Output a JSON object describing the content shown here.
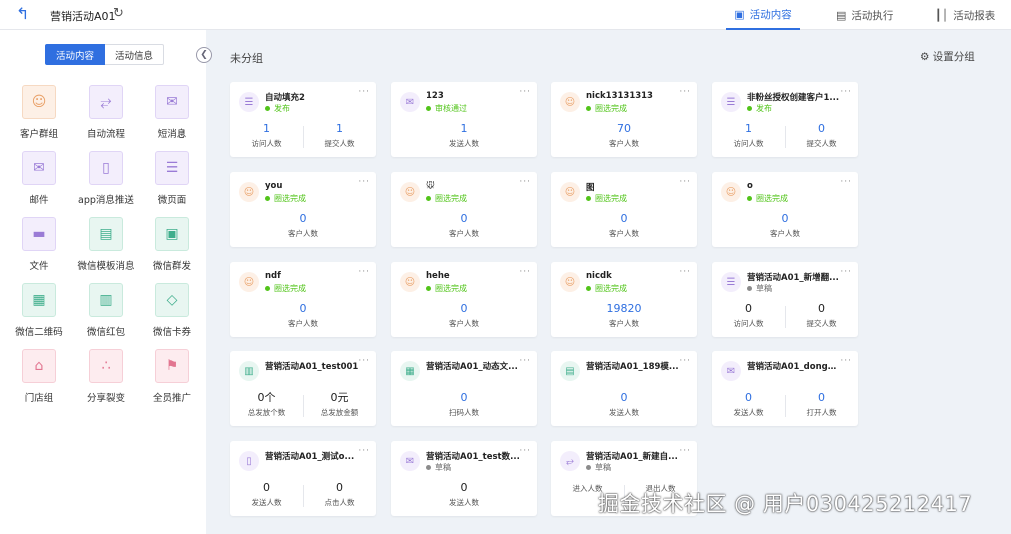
{
  "header": {
    "title": "营销活动A01",
    "tabs": [
      {
        "label": "活动内容",
        "icon": "content-icon",
        "active": true
      },
      {
        "label": "活动执行",
        "icon": "execute-icon",
        "active": false
      },
      {
        "label": "活动报表",
        "icon": "report-icon",
        "active": false
      }
    ]
  },
  "sidebar": {
    "segment": {
      "active": "活动内容",
      "other": "活动信息"
    },
    "tools": [
      {
        "label": "客户群组",
        "icon": "user-icon",
        "color": "#e9a067"
      },
      {
        "label": "自动流程",
        "icon": "flow-icon",
        "color": "#9a7bd6"
      },
      {
        "label": "短消息",
        "icon": "sms-icon",
        "color": "#9a7bd6"
      },
      {
        "label": "邮件",
        "icon": "mail-icon",
        "color": "#9a7bd6"
      },
      {
        "label": "app消息推送",
        "icon": "push-icon",
        "color": "#9a7bd6"
      },
      {
        "label": "微页面",
        "icon": "page-icon",
        "color": "#9a7bd6"
      },
      {
        "label": "文件",
        "icon": "file-icon",
        "color": "#9a7bd6"
      },
      {
        "label": "微信模板消息",
        "icon": "wechat-template-icon",
        "color": "#3fae8c"
      },
      {
        "label": "微信群发",
        "icon": "wechat-mass-icon",
        "color": "#3fae8c"
      },
      {
        "label": "微信二维码",
        "icon": "qrcode-icon",
        "color": "#3fae8c"
      },
      {
        "label": "微信红包",
        "icon": "red-packet-icon",
        "color": "#3fae8c"
      },
      {
        "label": "微信卡券",
        "icon": "coupon-icon",
        "color": "#3fae8c"
      },
      {
        "label": "门店组",
        "icon": "store-icon",
        "color": "#e27590"
      },
      {
        "label": "分享裂变",
        "icon": "share-icon",
        "color": "#e27590"
      },
      {
        "label": "全员推广",
        "icon": "promote-icon",
        "color": "#e27590"
      }
    ]
  },
  "main": {
    "group_title": "未分组",
    "set_group_label": "设置分组",
    "cards": [
      {
        "name": "自动填充2",
        "status": "发布",
        "status_color": "#52c41a",
        "icon": "page-icon",
        "tone": "pur",
        "stats": [
          {
            "value": "1",
            "label": "访问人数"
          },
          {
            "value": "1",
            "label": "提交人数"
          }
        ]
      },
      {
        "name": "123",
        "status": "审核通过",
        "status_color": "#52c41a",
        "icon": "sms-icon",
        "tone": "pur",
        "stats": [
          {
            "value": "1",
            "label": "发送人数"
          }
        ]
      },
      {
        "name": "nick13131313",
        "status": "圈选完成",
        "status_color": "#52c41a",
        "icon": "user-icon",
        "tone": "org",
        "stats": [
          {
            "value": "70",
            "label": "客户人数"
          }
        ]
      },
      {
        "name": "非粉丝授权创建客户1...",
        "status": "发布",
        "status_color": "#52c41a",
        "icon": "page-icon",
        "tone": "pur",
        "stats": [
          {
            "value": "1",
            "label": "访问人数"
          },
          {
            "value": "0",
            "label": "提交人数"
          }
        ]
      },
      {
        "name": "you",
        "status": "圈选完成",
        "status_color": "#52c41a",
        "icon": "user-icon",
        "tone": "org",
        "stats": [
          {
            "value": "0",
            "label": "客户人数"
          }
        ]
      },
      {
        "name": "🐭",
        "status": "圈选完成",
        "status_color": "#52c41a",
        "icon": "user-icon",
        "tone": "org",
        "stats": [
          {
            "value": "0",
            "label": "客户人数"
          }
        ]
      },
      {
        "name": "图",
        "status": "圈选完成",
        "status_color": "#52c41a",
        "icon": "user-icon",
        "tone": "org",
        "stats": [
          {
            "value": "0",
            "label": "客户人数"
          }
        ]
      },
      {
        "name": "o",
        "status": "圈选完成",
        "status_color": "#52c41a",
        "icon": "user-icon",
        "tone": "org",
        "stats": [
          {
            "value": "0",
            "label": "客户人数"
          }
        ]
      },
      {
        "name": "ndf",
        "status": "圈选完成",
        "status_color": "#52c41a",
        "icon": "user-icon",
        "tone": "org",
        "stats": [
          {
            "value": "0",
            "label": "客户人数"
          }
        ]
      },
      {
        "name": "hehe",
        "status": "圈选完成",
        "status_color": "#52c41a",
        "icon": "user-icon",
        "tone": "org",
        "stats": [
          {
            "value": "0",
            "label": "客户人数"
          }
        ]
      },
      {
        "name": "nicdk",
        "status": "圈选完成",
        "status_color": "#52c41a",
        "icon": "user-icon",
        "tone": "org",
        "stats": [
          {
            "value": "19820",
            "label": "客户人数"
          }
        ]
      },
      {
        "name": "营销活动A01_新增翻...",
        "status": "草稿",
        "status_color": "#8c8c8c",
        "icon": "page-icon",
        "tone": "pur",
        "dark": true,
        "stats": [
          {
            "value": "0",
            "label": "访问人数"
          },
          {
            "value": "0",
            "label": "提交人数"
          }
        ]
      },
      {
        "name": "营销活动A01_test001",
        "status": "",
        "status_color": "#8c8c8c",
        "icon": "red-packet-icon",
        "tone": "grn",
        "dark": true,
        "stats": [
          {
            "value": "0个",
            "label": "总发放个数"
          },
          {
            "value": "0元",
            "label": "总发放金额"
          }
        ]
      },
      {
        "name": "营销活动A01_动态文...",
        "status": "",
        "status_color": "#8c8c8c",
        "icon": "qrcode-icon",
        "tone": "grn",
        "stats": [
          {
            "value": "0",
            "label": "扫码人数"
          }
        ]
      },
      {
        "name": "营销活动A01_189模...",
        "status": "",
        "status_color": "#8c8c8c",
        "icon": "wechat-template-icon",
        "tone": "grn",
        "stats": [
          {
            "value": "0",
            "label": "发送人数"
          }
        ]
      },
      {
        "name": "营销活动A01_dongq...",
        "status": "",
        "status_color": "#8c8c8c",
        "icon": "mail-icon",
        "tone": "pur",
        "stats": [
          {
            "value": "0",
            "label": "发送人数"
          },
          {
            "value": "0",
            "label": "打开人数"
          }
        ]
      },
      {
        "name": "营销活动A01_测试o...",
        "status": "",
        "status_color": "#8c8c8c",
        "icon": "push-icon",
        "tone": "pur",
        "dark": true,
        "stats": [
          {
            "value": "0",
            "label": "发送人数"
          },
          {
            "value": "0",
            "label": "点击人数"
          }
        ]
      },
      {
        "name": "营销活动A01_test数...",
        "status": "草稿",
        "status_color": "#8c8c8c",
        "icon": "sms-icon",
        "tone": "pur",
        "dark": true,
        "stats": [
          {
            "value": "0",
            "label": "发送人数"
          }
        ]
      },
      {
        "name": "营销活动A01_新建自...",
        "status": "草稿",
        "status_color": "#8c8c8c",
        "icon": "flow-icon",
        "tone": "pur",
        "dark": true,
        "stats": [
          {
            "value": "",
            "label": "进入人数"
          },
          {
            "value": "",
            "label": "退出人数"
          }
        ]
      }
    ]
  },
  "watermark": "掘金技术社区 @ 用户030425212417"
}
